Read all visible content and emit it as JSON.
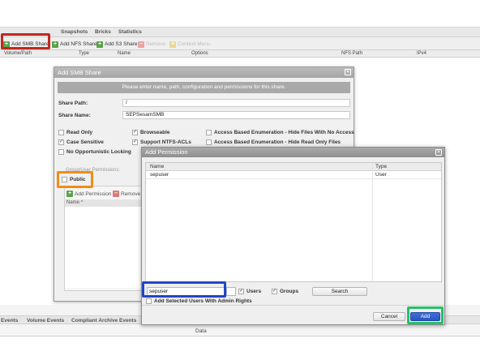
{
  "app": {
    "tabs": [
      "Snapshots",
      "Bricks",
      "Statistics"
    ],
    "toolbar": {
      "add_smb": "Add SMB Share",
      "add_nfs": "Add NFS Share",
      "add_s3": "Add S3 Share",
      "remove": "Remove",
      "context_menu": "Context Menu"
    },
    "columns": [
      "Volume/Path",
      "Type",
      "Name",
      "Options",
      "NFS Path",
      "IPv4"
    ],
    "bottom_tabs": [
      "Events",
      "Volume Events",
      "Compliant Archive Events"
    ],
    "data_label": "Data"
  },
  "smb_dialog": {
    "title": "Add SMB Share",
    "info": "Please enter name, path, configuration and permissions for this share.",
    "share_path_label": "Share Path:",
    "share_path_value": "/",
    "share_name_label": "Share Name:",
    "share_name_value": "SEPSesamSMB",
    "options": [
      {
        "label": "Read Only",
        "checked": false
      },
      {
        "label": "Browseable",
        "checked": true
      },
      {
        "label": "Access Based Enumeration - Hide Files With No Access",
        "checked": false
      },
      {
        "label": "Case Sensitive",
        "checked": true
      },
      {
        "label": "Support NTFS-ACLs",
        "checked": true
      },
      {
        "label": "Access Based Enumeration - Hide Read Only Files",
        "checked": false
      },
      {
        "label": "No Opportunistic Locking",
        "checked": false
      }
    ],
    "group_label": "Group/User Permissions:",
    "public_label": "Public",
    "add_permission": "Add Permission",
    "remove_prefix": "Remove",
    "name_column": "Name ^"
  },
  "permission_dialog": {
    "title": "Add Permission",
    "columns": [
      "Name",
      "Type"
    ],
    "rows": [
      {
        "name": "sepuser",
        "type": "User"
      }
    ],
    "search_value": "sepuser",
    "users_label": "Users",
    "groups_label": "Groups",
    "search_button": "Search",
    "admin_label": "Add Selected Users With Admin Rights",
    "cancel": "Cancel",
    "add": "Add"
  },
  "highlight_colors": {
    "add_smb": "#c0281e",
    "public": "#f08c1a",
    "search": "#2246c8",
    "add": "#27c06a"
  }
}
